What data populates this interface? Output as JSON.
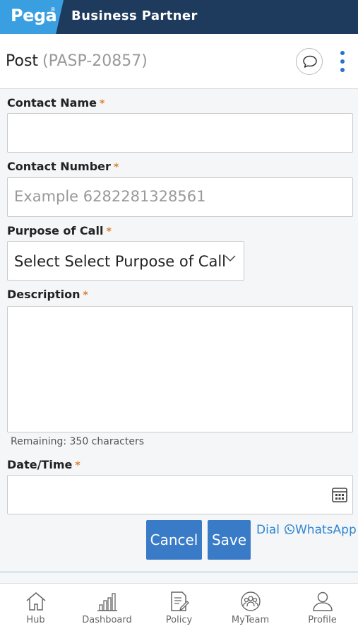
{
  "app": {
    "logo": "Pega",
    "logo_mark": "®",
    "title": "Business Partner"
  },
  "header": {
    "title": "Post",
    "case_id": "(PASP-20857)"
  },
  "form": {
    "contact_name": {
      "label": "Contact Name",
      "value": ""
    },
    "contact_number": {
      "label": "Contact Number",
      "placeholder": "Example 6282281328561"
    },
    "purpose": {
      "label": "Purpose of Call",
      "selected": "Select Select Purpose of Call"
    },
    "description": {
      "label": "Description",
      "remaining": "Remaining: 350 characters"
    },
    "datetime": {
      "label": "Date/Time",
      "value": ""
    },
    "required_mark": "*"
  },
  "actions": {
    "cancel": "Cancel",
    "save": "Save",
    "dial": "Dial",
    "whatsapp": "WhatsApp"
  },
  "nav": {
    "items": [
      {
        "label": "Hub",
        "icon": "home-icon"
      },
      {
        "label": "Dashboard",
        "icon": "bar-chart-icon"
      },
      {
        "label": "Policy",
        "icon": "policy-document-icon"
      },
      {
        "label": "MyTeam",
        "icon": "team-icon"
      },
      {
        "label": "Profile",
        "icon": "person-icon"
      }
    ]
  },
  "colors": {
    "topbar": "#1e3a5c",
    "logo_bg": "#3a9fe0",
    "primary": "#3a7bc8",
    "link": "#2e86d4",
    "required": "#d9822b"
  }
}
